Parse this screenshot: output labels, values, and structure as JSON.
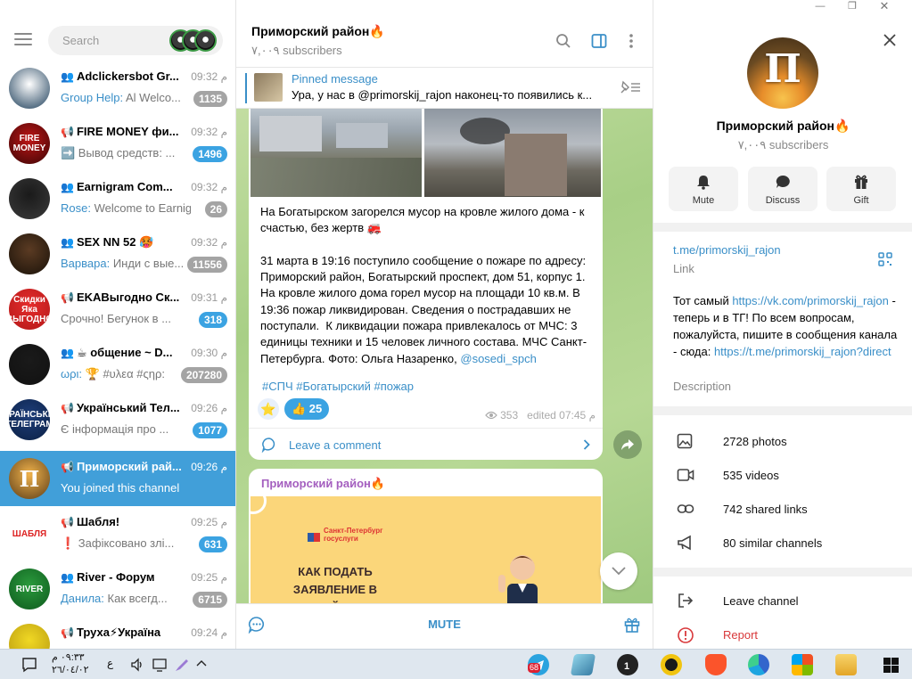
{
  "search": {
    "placeholder": "Search"
  },
  "chats": [
    {
      "title": "Adclickersbot Gr...",
      "type_icon": "group-icon",
      "time": "م 09:32",
      "sender": "Group Help:",
      "preview": " Al   Welco...",
      "badge": "1135",
      "badge_color": "#a4a4a4"
    },
    {
      "title": "FIRE MONEY фи...",
      "type_icon": "channel-icon",
      "time": "م 09:32",
      "sender": "",
      "preview": "➡️ Вывод средств: ...",
      "badge": "1496",
      "badge_color": "#3ba3e2"
    },
    {
      "title": "Earnigram Com...",
      "type_icon": "group-icon",
      "time": "م 09:32",
      "sender": "Rose:",
      "preview": " Welcome to Earnig...",
      "badge": "26",
      "badge_color": "#a4a4a4"
    },
    {
      "title": "SEX NN 52 🥵",
      "type_icon": "group-icon",
      "time": "م 09:32",
      "sender": "Варвара:",
      "preview": " Инди с вые...",
      "badge": "11556",
      "badge_color": "#a4a4a4"
    },
    {
      "title": "EKAВыгодно Ск...",
      "type_icon": "channel-icon",
      "time": "م 09:31",
      "sender": "",
      "preview": "Срочно! Бегунок в ...",
      "badge": "318",
      "badge_color": "#3ba3e2"
    },
    {
      "title": "☕ общение ~ D...",
      "type_icon": "group-icon",
      "time": "م 09:30",
      "sender": "ωρι:",
      "preview": " 🏆 #υλεα #ςηρ:",
      "badge": "207280",
      "badge_color": "#a4a4a4"
    },
    {
      "title": "Український Тел...",
      "type_icon": "channel-icon",
      "time": "م 09:26",
      "sender": "",
      "preview": "Є інформація про ...",
      "badge": "1077",
      "badge_color": "#3ba3e2"
    },
    {
      "title": "Приморский рай...",
      "type_icon": "channel-icon",
      "time": "م 09:26",
      "sender": "",
      "preview": "You joined this channel",
      "badge": "",
      "badge_color": ""
    },
    {
      "title": "Шабля!",
      "type_icon": "channel-icon",
      "time": "م 09:25",
      "sender": "",
      "preview": "❗ Зафіксовано злі...",
      "badge": "631",
      "badge_color": "#3ba3e2"
    },
    {
      "title": "River - Форум",
      "type_icon": "group-icon",
      "time": "م 09:25",
      "sender": "Данила:",
      "preview": "  Как всегд...",
      "badge": "6715",
      "badge_color": "#a4a4a4"
    },
    {
      "title": "Труха⚡Україна",
      "type_icon": "channel-icon",
      "time": "م 09:24",
      "sender": "",
      "preview": "",
      "badge": "",
      "badge_color": ""
    }
  ],
  "avatars": [
    {
      "label": "",
      "colors": [
        "#ffffff",
        "#1d3e5a"
      ]
    },
    {
      "label": "FIRE MONEY",
      "colors": [
        "#c01616",
        "#3a0505"
      ]
    },
    {
      "label": "",
      "colors": [
        "#1a1a1a",
        "#3a3a3a"
      ]
    },
    {
      "label": "",
      "colors": [
        "#5b3b23",
        "#1a1209"
      ]
    },
    {
      "label": "Скидки Яка ВЫГОДНО",
      "colors": [
        "#e52d2d",
        "#b31717"
      ]
    },
    {
      "label": "",
      "colors": [
        "#1a1a1a",
        "#111111"
      ]
    },
    {
      "label": "УКРАЇНСЬКИЙ ТЕЛЕГРАМ",
      "colors": [
        "#1e3e7a",
        "#0b2044"
      ]
    },
    {
      "label": "П",
      "colors": [
        "#f1b34b",
        "#5b3c18"
      ]
    },
    {
      "label": "ШАБЛЯ",
      "colors": [
        "#ffffff",
        "#ffffff"
      ]
    },
    {
      "label": "RIVER",
      "colors": [
        "#2a9a3c",
        "#0f5a1e"
      ]
    },
    {
      "label": "",
      "colors": [
        "#f0d824",
        "#b89a0f"
      ]
    }
  ],
  "channel": {
    "title": "Приморский район🔥",
    "subscribers": "٧,٠٠٩ subscribers"
  },
  "pinned": {
    "label": "Pinned message",
    "text": "Ура, у нас в @primorskij_rajon наконец-то появились к..."
  },
  "post": {
    "text_plain": "На Богатырском загорелся мусор на кровле жилого дома - к счастью, без жертв 🚒\n\n31 марта в 19:16 поступило сообщение о пожаре по адресу: Приморский район, Богатырский проспект, дом 51, корпус 1. На кровле жилого дома горел мусор на площади 10 кв.м. В 19:36 пожар ликвидирован. Сведения о пострадавших не поступали.  К ликвидации пожара привлекалось от МЧС: 3 единицы техники и 15 человек личного состава. МЧС Санкт-Петербурга. Фото: Ольга Назаренко, ",
    "mention": "@sosedi_spch",
    "hashtags": "#СПЧ #Богатырский #пожар",
    "reaction_star": "⭐",
    "reaction_like": "👍 25",
    "views": "353",
    "edited": "edited 07:45 م",
    "comment_label": "Leave a comment"
  },
  "post2": {
    "author": "Приморский район🔥",
    "banner_brand": "Санкт-Петербург госуслуги",
    "banner_title": "КАК ПОДАТЬ ЗАЯВЛЕНИЕ В ПЕРВЫЙ КЛАСС"
  },
  "footer": {
    "mute_label": "MUTE"
  },
  "info": {
    "title": "Приморский район🔥",
    "subscribers": "٧,٠٠٩ subscribers",
    "avatar_letter": "П",
    "actions": [
      {
        "label": "Mute",
        "icon": "bell-icon"
      },
      {
        "label": "Discuss",
        "icon": "chat-bubble-icon"
      },
      {
        "label": "Gift",
        "icon": "gift-icon"
      }
    ],
    "link": "t.me/primorskij_rajon",
    "link_caption": "Link",
    "desc_1": "Тот самый ",
    "desc_link1": "https://vk.com/primorskij_rajon",
    "desc_2": " - теперь и в ТГ! По всем вопросам, пожалуйста, пишите в сообщения канала - сюда: ",
    "desc_link2": "https://t.me/primorskij_rajon?direct",
    "desc_caption": "Description",
    "media": [
      {
        "label": "2728 photos",
        "icon": "photo-icon"
      },
      {
        "label": "535 videos",
        "icon": "video-icon"
      },
      {
        "label": "742 shared links",
        "icon": "link-icon"
      },
      {
        "label": "80 similar channels",
        "icon": "megaphone-icon"
      }
    ],
    "leave": "Leave channel",
    "report": "Report"
  },
  "taskbar": {
    "time": "٠٩:٣٣ م",
    "date": "٢٦/٠٤/٠٢",
    "lang": "ع",
    "telegram_badge": "68",
    "app_badge": "1"
  },
  "colors": {
    "accent": "#3a8fc8",
    "active_chat": "#419fd9",
    "badge_unmuted": "#3ba3e2",
    "badge_muted": "#a4a4a4",
    "report": "#d8383a",
    "author": "#a45fbf"
  }
}
